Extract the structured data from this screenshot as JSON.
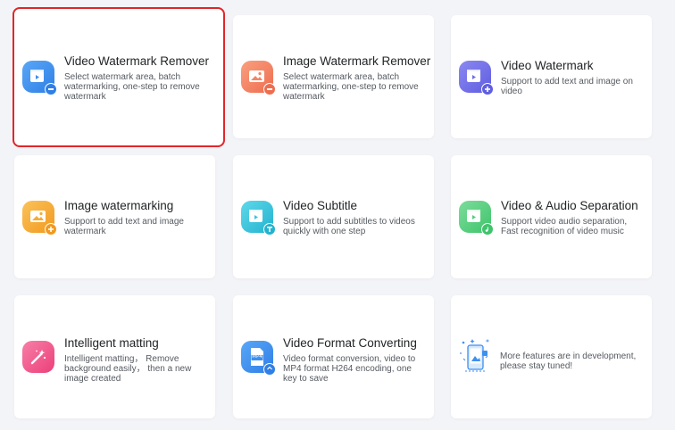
{
  "cards": [
    {
      "title": "Video Watermark Remover",
      "desc": "Select watermark area, batch watermarking, one-step to remove watermark",
      "icon": "video-watermark-remover-icon",
      "color": "#3d8ff0"
    },
    {
      "title": "Image Watermark Remover",
      "desc": "Select watermark area, batch watermarking, one-step to remove watermark",
      "icon": "image-watermark-remover-icon",
      "color": "#f48563"
    },
    {
      "title": "Video Watermark",
      "desc": "Support to add text and image on video",
      "icon": "video-watermark-icon",
      "color": "#6f6ee8"
    },
    {
      "title": "Image watermarking",
      "desc": "Support to add text and image watermark",
      "icon": "image-watermarking-icon",
      "color": "#f6ac33"
    },
    {
      "title": "Video Subtitle",
      "desc": "Support to add subtitles to videos quickly with one step",
      "icon": "video-subtitle-icon",
      "color": "#35c8de"
    },
    {
      "title": "Video & Audio Separation",
      "desc": "Support video audio separation, Fast recognition of video music",
      "icon": "video-audio-separation-icon",
      "color": "#52cf7d"
    },
    {
      "title": "Intelligent matting",
      "desc": "Intelligent matting， Remove background easily， then a new image created",
      "icon": "intelligent-matting-icon",
      "color": "#f25a8f"
    },
    {
      "title": "Video Format Converting",
      "desc": "Video format conversion, video to MP4 format H264 encoding, one key to save",
      "icon": "video-format-converting-icon",
      "color": "#3d8ff0",
      "icon_label": "MP4"
    },
    {
      "title": "",
      "desc": "More features are in development, please stay tuned!",
      "icon": "in-development-illustration-icon",
      "color": "#3d8ff0"
    }
  ],
  "selected_index": 0
}
